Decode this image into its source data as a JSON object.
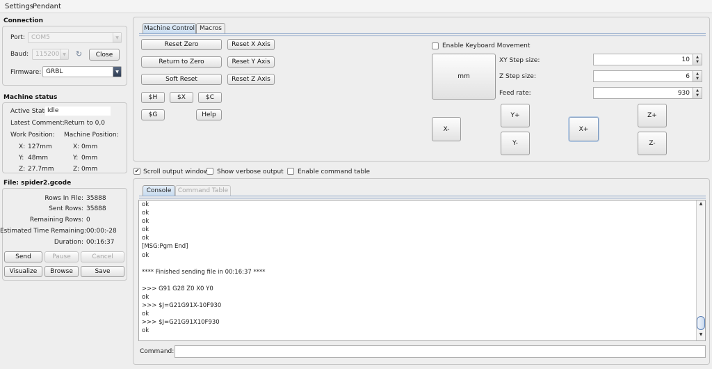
{
  "menu": [
    "Settings",
    "Pendant"
  ],
  "connection": {
    "section_title": "Connection",
    "port_label": "Port:",
    "port_value": "COM5",
    "baud_label": "Baud:",
    "baud_value": "115200",
    "refresh_icon": "refresh-icon",
    "close_label": "Close",
    "firmware_label": "Firmware:",
    "firmware_value": "GRBL"
  },
  "machine_status": {
    "section_title": "Machine status",
    "active_state_label": "Active State:",
    "active_state_value": "Idle",
    "latest_comment_label": "Latest Comment:",
    "latest_comment_value": "Return to 0,0",
    "work_position_label": "Work Position:",
    "machine_position_label": "Machine Position:",
    "work": [
      {
        "axis": "X:",
        "value": "127mm"
      },
      {
        "axis": "Y:",
        "value": "48mm"
      },
      {
        "axis": "Z:",
        "value": "27.7mm"
      }
    ],
    "machine": [
      {
        "axis": "X:",
        "value": "0mm"
      },
      {
        "axis": "Y:",
        "value": "0mm"
      },
      {
        "axis": "Z:",
        "value": "0mm"
      }
    ]
  },
  "file": {
    "section_title": "File: spider2.gcode",
    "rows": [
      {
        "label": "Rows In File:",
        "value": "35888"
      },
      {
        "label": "Sent Rows:",
        "value": "35888"
      },
      {
        "label": "Remaining Rows:",
        "value": "0"
      },
      {
        "label": "Estimated Time Remaining:",
        "value": "00:00:-28"
      },
      {
        "label": "Duration:",
        "value": "00:16:37"
      }
    ],
    "buttons": {
      "send": "Send",
      "pause": "Pause",
      "cancel": "Cancel",
      "visualize": "Visualize",
      "browse": "Browse",
      "save": "Save"
    }
  },
  "machine_tabs": [
    "Machine Control",
    "Macros"
  ],
  "control": {
    "reset_zero": "Reset Zero",
    "return_to_zero": "Return to Zero",
    "soft_reset": "Soft Reset",
    "reset_x": "Reset X Axis",
    "reset_y": "Reset Y Axis",
    "reset_z": "Reset Z Axis",
    "cmd_h": "$H",
    "cmd_x": "$X",
    "cmd_c": "$C",
    "cmd_g": "$G",
    "help": "Help"
  },
  "jog": {
    "keyboard_label": "Enable Keyboard Movement",
    "keyboard_checked": false,
    "units_label": "mm",
    "xy_step_label": "XY Step size:",
    "xy_step_value": "10",
    "z_step_label": "Z Step size:",
    "z_step_value": "6",
    "feed_label": "Feed rate:",
    "feed_value": "930",
    "x_minus": "X-",
    "x_plus": "X+",
    "y_plus": "Y+",
    "y_minus": "Y-",
    "z_plus": "Z+",
    "z_minus": "Z-"
  },
  "options": {
    "scroll_label": "Scroll output window",
    "scroll_checked": true,
    "verbose_label": "Show verbose output",
    "verbose_checked": false,
    "cmdtable_label": "Enable command table",
    "cmdtable_checked": false
  },
  "console_tabs": [
    "Console",
    "Command Table"
  ],
  "console_lines": "ok\nok\nok\nok\nok\n[MSG:Pgm End]\nok\n\n**** Finished sending file in 00:16:37 ****\n\n>>> G91 G28 Z0 X0 Y0\nok\n>>> $J=G21G91X-10F930\nok\n>>> $J=G21G91X10F930\nok",
  "command": {
    "label": "Command:",
    "value": ""
  },
  "colors": {
    "selected_tab": "#c9dcef",
    "panel_border": "#c6c6c6"
  }
}
